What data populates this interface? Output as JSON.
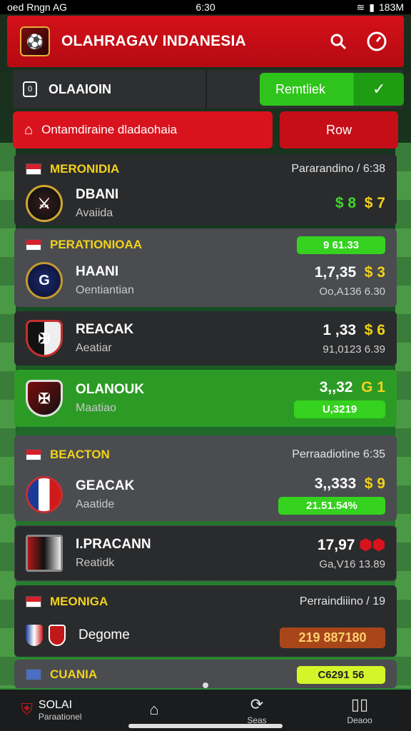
{
  "status_bar": {
    "left": "oed Rngn AG",
    "time": "6:30",
    "right": "183M"
  },
  "header": {
    "title": "OLAHRAGAV INDANESIA"
  },
  "section": {
    "label": "OLAAIOIN"
  },
  "action": {
    "green_label": "Remtliek",
    "alert_label": "Ontamdiraine dladaohaia",
    "row_label": "Row"
  },
  "leagues": [
    {
      "name": "MERONIDIA",
      "meta": "Pararandino / 6:38"
    },
    {
      "name": "PERATIONIOAA",
      "badge": "9 61.33"
    },
    {
      "name": "BEACTON",
      "meta": "Perraadiotine 6:35"
    },
    {
      "name": "MEONIGA",
      "meta": "Perraindiiino / 19"
    },
    {
      "name": "CUANIA",
      "badge": "C6291 56"
    }
  ],
  "matches": [
    {
      "team": "DBANI",
      "sub": "Avaiida",
      "odds_a": "$ 8",
      "odds_b": "$ 7"
    },
    {
      "team": "HAANI",
      "sub": "Oentiantian",
      "odds_a": "1,7,35",
      "odds_b": "$ 3",
      "line": "Oo,A136 6.30"
    },
    {
      "team": "REACAK",
      "sub": "Aeatiar",
      "odds_a": "1 ,33",
      "odds_b": "$ 6",
      "line": "91,0123 6.39"
    },
    {
      "team": "OLANOUK",
      "sub": "Maatiao",
      "odds_a": "3,,32",
      "odds_b": "G 1",
      "badge": "U,3219"
    },
    {
      "team": "GEACAK",
      "sub": "Aaatide",
      "odds_a": "3,,333",
      "odds_b": "$ 9",
      "badge": "21.51.54%"
    },
    {
      "team": "I.PRACANN",
      "sub": "Reatidk",
      "odds_a": "17,97",
      "odds_b": "",
      "line": "Ga,V16 13.89"
    },
    {
      "team": "Degome",
      "sub": "",
      "badge": "219 887180"
    }
  ],
  "bottom_nav": [
    {
      "label": "SOLAI",
      "sub": "Paraationel",
      "icon": "crest-icon"
    },
    {
      "label": "",
      "icon": "home-icon"
    },
    {
      "label": "Seas",
      "icon": "refresh-icon"
    },
    {
      "label": "Deaoo",
      "icon": "book-icon"
    }
  ],
  "colors": {
    "accent": "#d4101a",
    "positive": "#35d21f",
    "highlight": "#f2d21b"
  }
}
